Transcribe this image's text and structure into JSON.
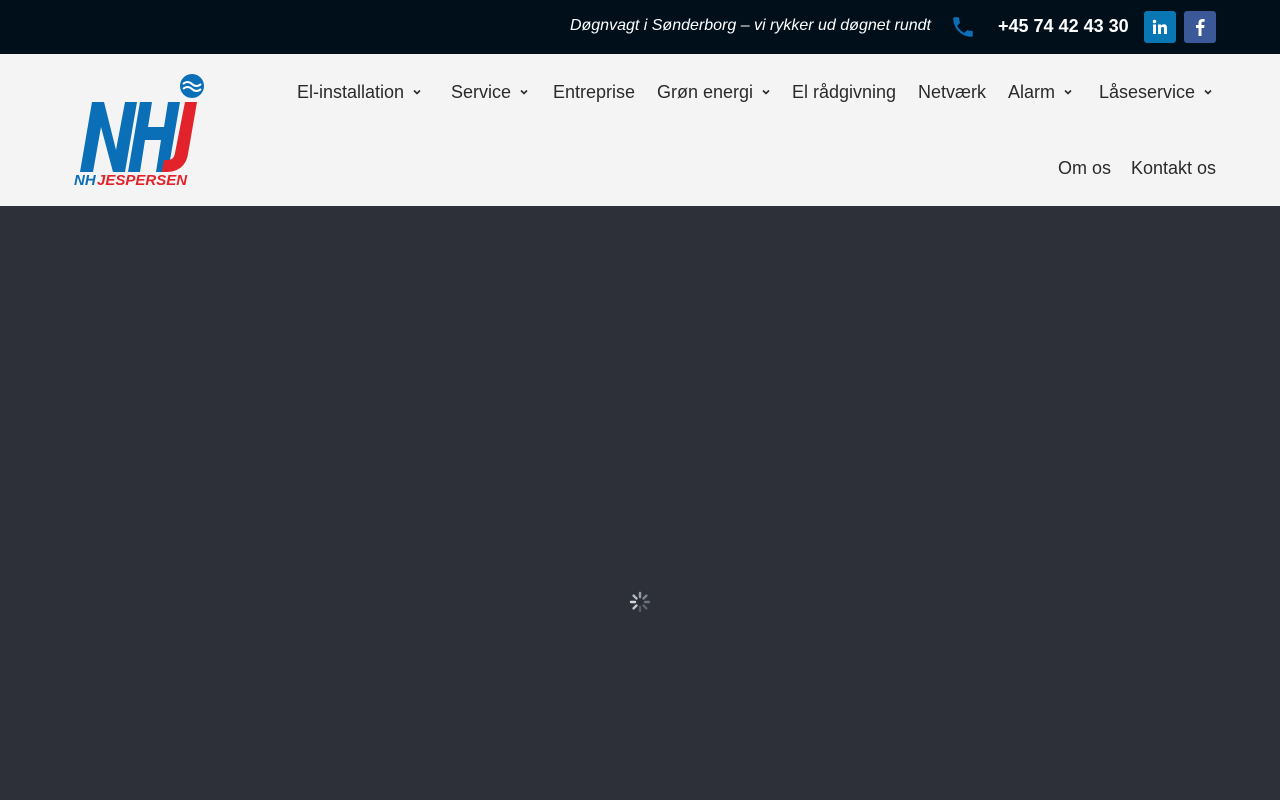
{
  "colors": {
    "topbar_bg": "#000f1a",
    "header_bg": "#f4f4f4",
    "main_bg": "#2d3039",
    "phone_icon": "#0a6fb7",
    "linkedin": "#0a77b5",
    "facebook": "#3b5998",
    "logo_blue": "#0a6fb7",
    "logo_red": "#e3232b"
  },
  "topbar": {
    "tagline": "Døgnvagt i Sønderborg – vi rykker ud døgnet rundt",
    "phone_icon": "phone-icon",
    "phone": "+45 74 42 43 30",
    "social": [
      {
        "name": "linkedin",
        "icon": "linkedin-icon"
      },
      {
        "name": "facebook",
        "icon": "facebook-icon"
      }
    ]
  },
  "logo": {
    "mark": "NHJ",
    "wordmark": "NHJESPERSEN"
  },
  "nav": {
    "items": [
      {
        "label": "El-installation",
        "dropdown": true
      },
      {
        "label": "Service",
        "dropdown": true
      },
      {
        "label": "Entreprise",
        "dropdown": false
      },
      {
        "label": "Grøn energi",
        "dropdown": true
      },
      {
        "label": "El rådgivning",
        "dropdown": false
      },
      {
        "label": "Netværk",
        "dropdown": false
      },
      {
        "label": "Alarm",
        "dropdown": true
      },
      {
        "label": "Låseservice",
        "dropdown": true
      },
      {
        "label": "Om os",
        "dropdown": false
      },
      {
        "label": "Kontakt os",
        "dropdown": false
      }
    ]
  },
  "main": {
    "loading_icon": "loading-spinner-icon"
  }
}
